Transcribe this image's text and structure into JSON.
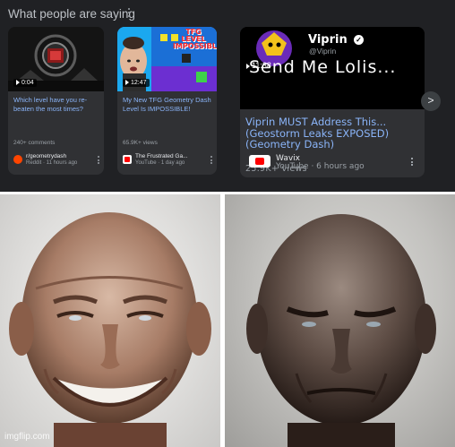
{
  "section": {
    "title": "What people are saying"
  },
  "cards": [
    {
      "duration": "0:04",
      "headline": "Which level have you re-beaten the most times?",
      "count": "240+ comments",
      "source_name": "r/geometrydash",
      "source_meta": "Reddit · 11 hours ago",
      "source_logo_color": "#ff4500"
    },
    {
      "duration": "12:47",
      "thumb_text": "TFG LEVEL IMPOSSIBLE",
      "headline": "My New TFG Geometry Dash Level Is IMPOSSIBLE!",
      "count": "65.9K+ views",
      "source_name": "The Frustrated Ga...",
      "source_meta": "YouTube · 1 day ago",
      "source_logo_color": "#ff0000"
    },
    {
      "channel_name": "Viprin",
      "channel_handle": "@Viprin",
      "duration": "11:38",
      "thumb_caption": "Send Me Lolis...",
      "headline": "Viprin MUST Address This... (Geostorm Leaks EXPOSED) (Geometry Dash)",
      "count": "25.9K+ views",
      "source_name": "Wavix",
      "source_meta": "YouTube · 6 hours ago",
      "source_logo_color": "#ff0000"
    }
  ],
  "next_button": ">",
  "meme": {
    "watermark": "imgflip.com"
  }
}
